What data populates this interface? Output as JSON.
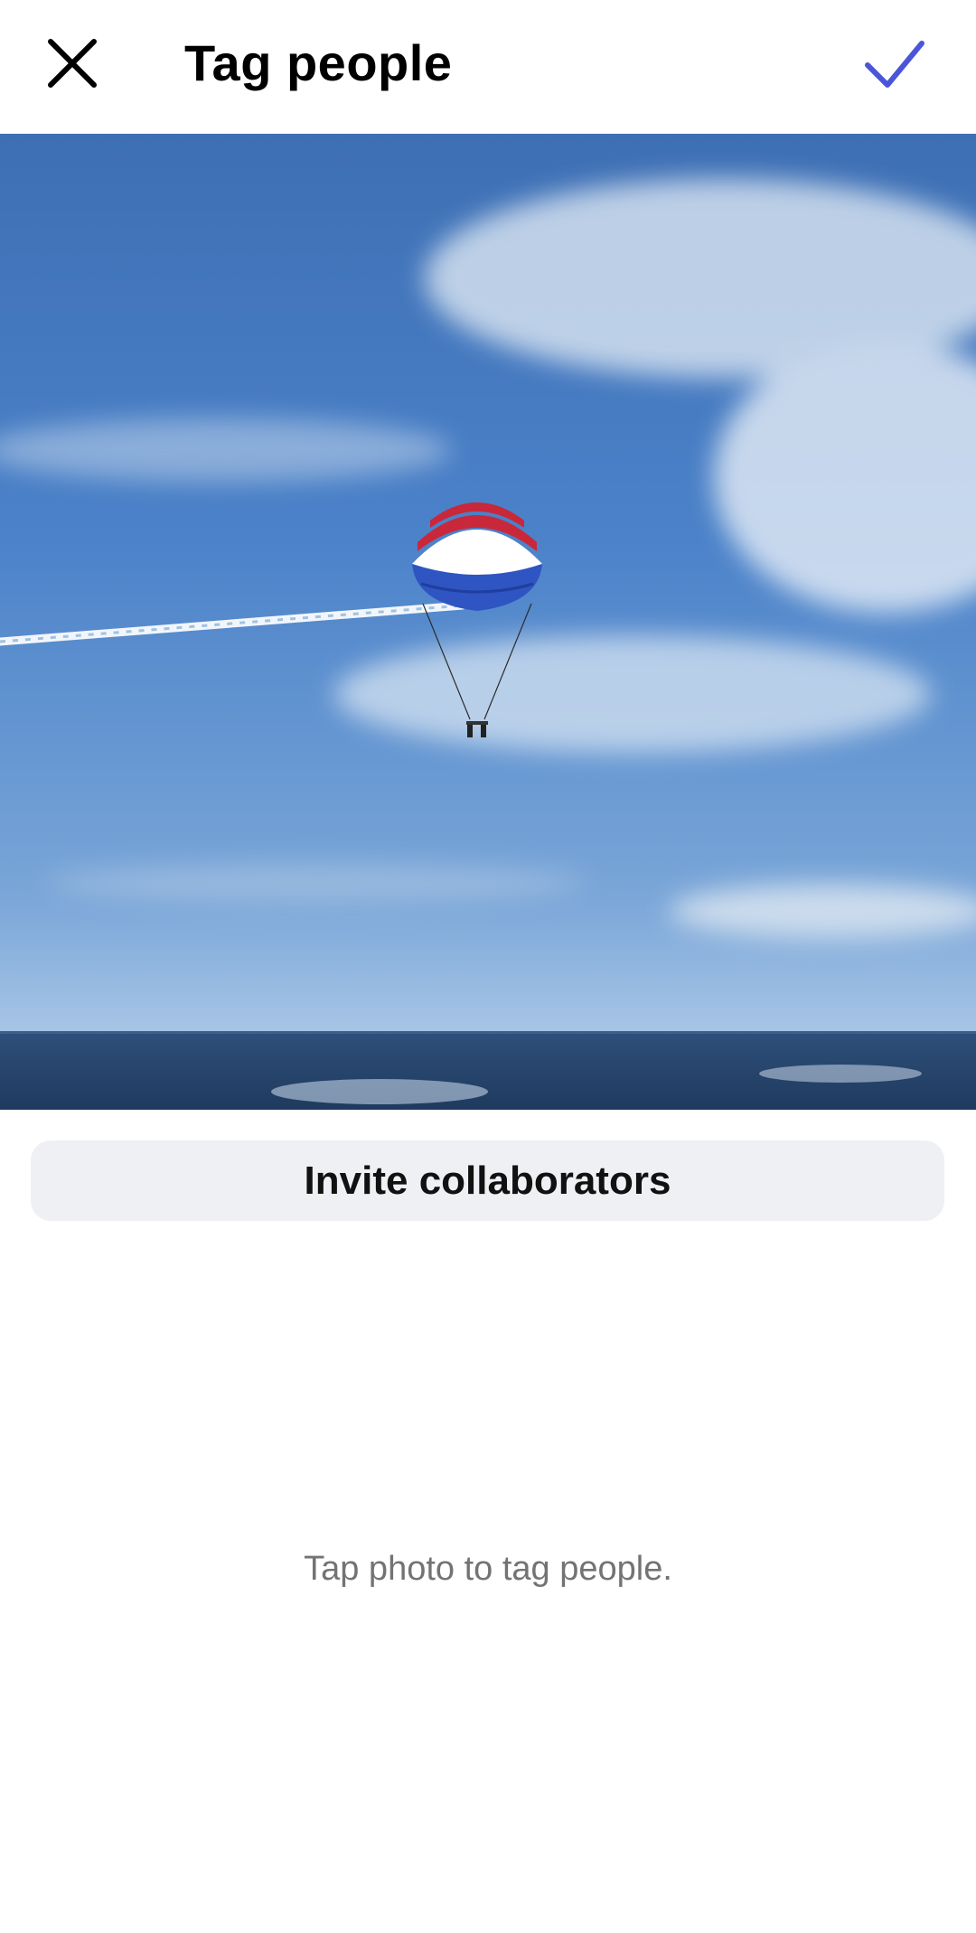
{
  "header": {
    "title": "Tag people",
    "close_icon": "close-icon",
    "done_icon": "check-icon",
    "done_color": "#4a55d9"
  },
  "photo": {
    "subject": "parasail-photo",
    "sky_color": "#4a7ec6",
    "sea_color": "#2c4b72"
  },
  "invite_button": {
    "label": "Invite collaborators"
  },
  "hint": {
    "text": "Tap photo to tag people."
  }
}
